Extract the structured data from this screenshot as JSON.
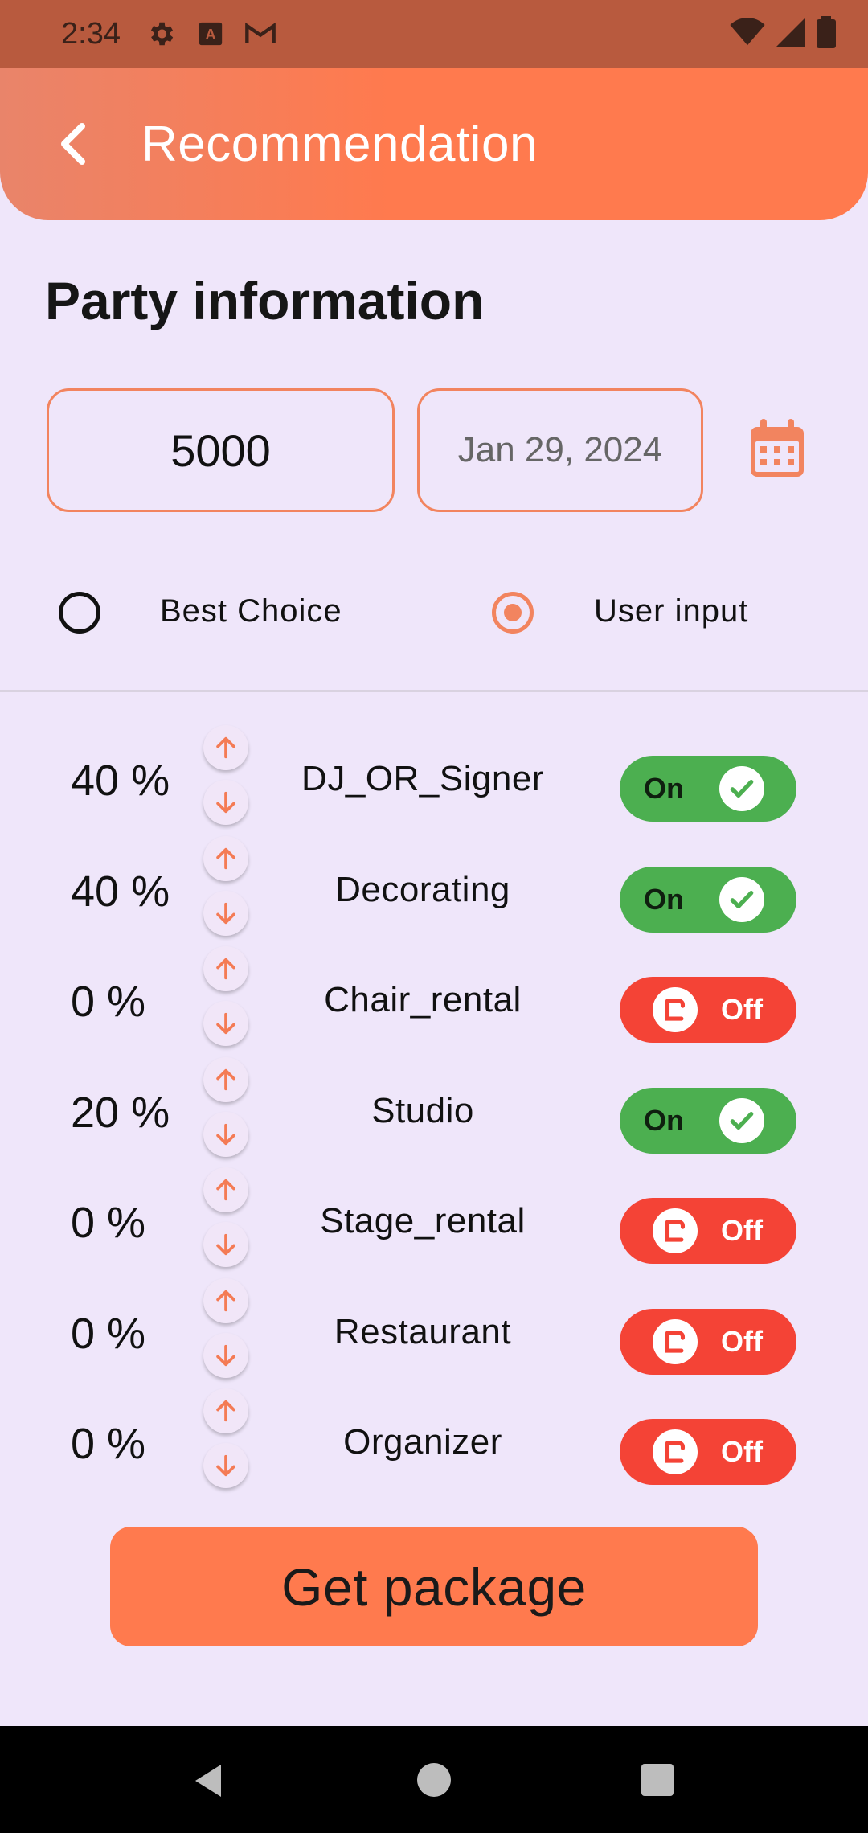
{
  "status_bar": {
    "time": "2:34",
    "icons": [
      "settings-icon",
      "font-icon",
      "gmail-icon",
      "wifi-icon",
      "signal-icon",
      "battery-icon"
    ]
  },
  "app_bar": {
    "title": "Recommendation",
    "back_icon": "chevron-left-icon"
  },
  "section_title": "Party information",
  "amount_field": {
    "value": "5000"
  },
  "date_field": {
    "value": "Jan 29, 2024"
  },
  "calendar_icon": "calendar-icon",
  "mode": {
    "options": [
      {
        "label": "Best Choice",
        "selected": false
      },
      {
        "label": "User input",
        "selected": true
      }
    ]
  },
  "items": [
    {
      "percent": "40 %",
      "name": "DJ_OR_Signer",
      "toggle": "On"
    },
    {
      "percent": "40 %",
      "name": "Decorating",
      "toggle": "On"
    },
    {
      "percent": "0 %",
      "name": "Chair_rental",
      "toggle": "Off"
    },
    {
      "percent": "20 %",
      "name": "Studio",
      "toggle": "On"
    },
    {
      "percent": "0 %",
      "name": "Stage_rental",
      "toggle": "Off"
    },
    {
      "percent": "0 %",
      "name": "Restaurant",
      "toggle": "Off"
    },
    {
      "percent": "0 %",
      "name": "Organizer",
      "toggle": "Off"
    }
  ],
  "get_package_button": "Get package",
  "colors": {
    "background": "#efe6fa",
    "accent": "#ff7a4e",
    "on": "#4caf50",
    "off": "#f44336",
    "status_bar": "#b85a3e"
  }
}
